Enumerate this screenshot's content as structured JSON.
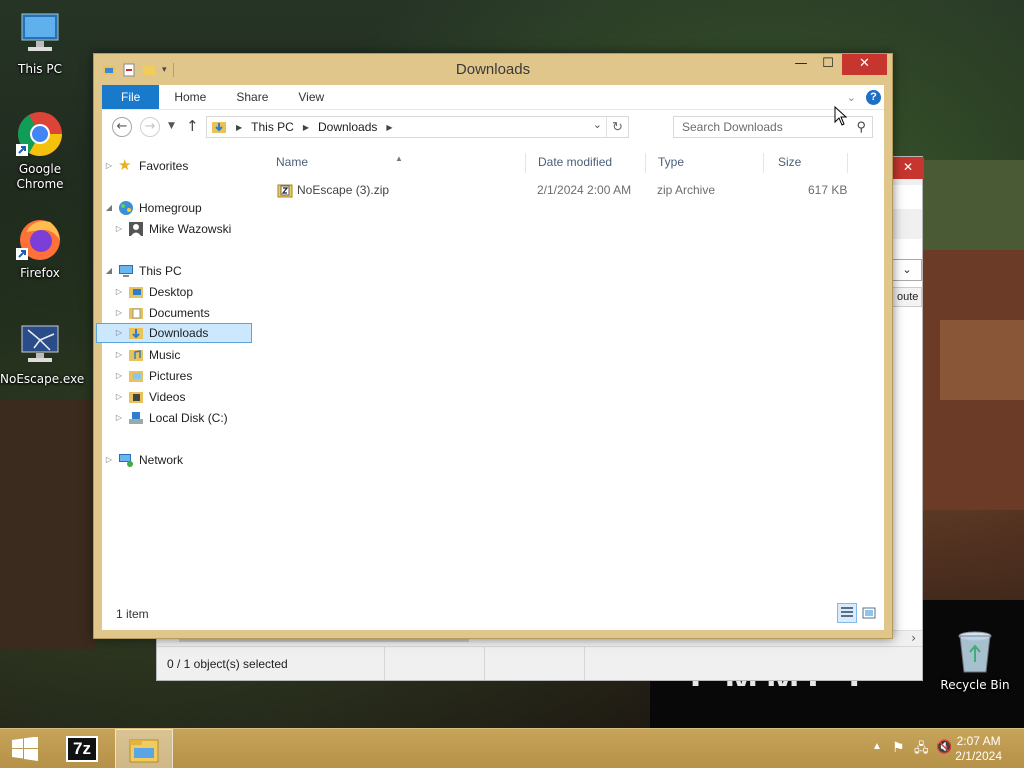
{
  "desktop": {
    "icons": [
      {
        "label": "This PC",
        "icon": "computer-monitor"
      },
      {
        "label": "Google Chrome",
        "icon": "chrome-logo"
      },
      {
        "label": "Firefox",
        "icon": "firefox-logo"
      },
      {
        "label": "NoEscape.exe",
        "icon": "monitor-with-cracked-screen"
      }
    ],
    "recycle_bin": {
      "label": "Recycle Bin",
      "icon": "recycle-bin"
    }
  },
  "window": {
    "title": "Downloads",
    "ribbon": {
      "tabs": [
        "File",
        "Home",
        "Share",
        "View"
      ]
    },
    "address": {
      "crumbs": [
        "This PC",
        "Downloads"
      ]
    },
    "search": {
      "placeholder": "Search Downloads"
    },
    "nav": {
      "favorites": "Favorites",
      "homegroup": "Homegroup",
      "user": "Mike Wazowski",
      "this_pc": "This PC",
      "desktop": "Desktop",
      "documents": "Documents",
      "downloads": "Downloads",
      "music": "Music",
      "pictures": "Pictures",
      "videos": "Videos",
      "local_disk": "Local Disk (C:)",
      "network": "Network"
    },
    "columns": {
      "name": "Name",
      "date": "Date modified",
      "type": "Type",
      "size": "Size"
    },
    "files": [
      {
        "name": "NoEscape (3).zip",
        "date": "2/1/2024 2:00 AM",
        "type": "zip Archive",
        "size": "617 KB"
      }
    ],
    "status": {
      "item_count": "1 item"
    }
  },
  "background_window": {
    "status": "0 / 1 object(s) selected",
    "partial_text": "oute"
  },
  "taskbar": {
    "apps": [
      "start",
      "7-zip",
      "file-explorer"
    ],
    "sevenzip_label": "7z",
    "clock": {
      "time": "2:07 AM",
      "date": "2/1/2024"
    }
  },
  "colors": {
    "window_frame": "#e0c68b",
    "taskbar": "#bf9c52",
    "ribbon_file": "#1979ca",
    "close_button": "#c7362e",
    "selection": "#cce8ff"
  }
}
